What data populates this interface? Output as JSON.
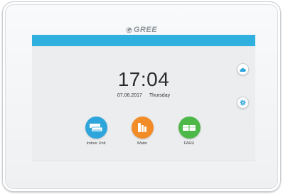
{
  "brand": {
    "logo_text": "GREE"
  },
  "clock": {
    "time": "17:04",
    "date": "07.06.2017",
    "weekday": "Thursday"
  },
  "side_buttons": [
    {
      "name": "cloud-button",
      "icon": "cloud-icon"
    },
    {
      "name": "settings-button",
      "icon": "gear-icon"
    }
  ],
  "tiles": [
    {
      "label": "Indoor Unit",
      "icon": "indoor-unit-icon",
      "color": "#2ea6dc"
    },
    {
      "label": "Water",
      "icon": "water-heater-icon",
      "color": "#f28c28"
    },
    {
      "label": "FAHU",
      "icon": "fahu-icon",
      "color": "#4cb848"
    }
  ],
  "colors": {
    "accent_bar": "#2fb0df",
    "side_icon": "#2ea6dc"
  }
}
